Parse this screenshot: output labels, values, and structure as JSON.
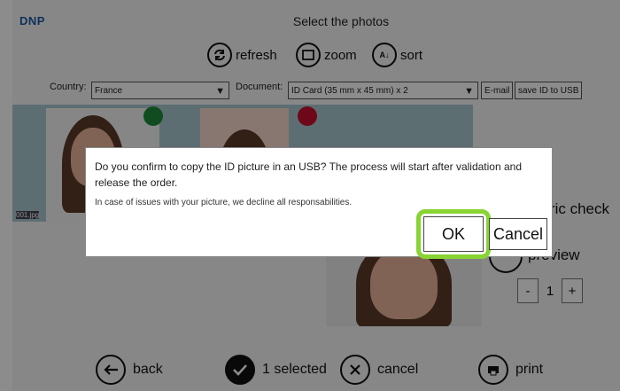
{
  "header": {
    "logo": "DNP",
    "title": "Select the photos"
  },
  "toolbar": {
    "refresh_label": "refresh",
    "zoom_label": "zoom",
    "sort_label": "sort"
  },
  "filters": {
    "country_label": "Country:",
    "country_value": "France",
    "document_label": "Document:",
    "document_value": "ID Card (35 mm x 45 mm) x 2",
    "email_label": "E-mail",
    "save_usb_label": "save ID to USB"
  },
  "photos": [
    {
      "filename": "001.jpg",
      "status_color": "#1e8a3a"
    },
    {
      "filename": "",
      "status_color": "#c8102e"
    }
  ],
  "side_panel": {
    "biometric_label": "Biometric check",
    "preview_label": "preview",
    "quantity": "1",
    "minus_label": "-",
    "plus_label": "+"
  },
  "bottom_bar": {
    "back_label": "back",
    "selected_label": "1 selected",
    "cancel_label": "cancel",
    "print_label": "print"
  },
  "dialog": {
    "message": "Do you confirm to copy the ID picture in an USB? The process will start after validation and release the order.",
    "note": "In case of issues with your picture, we decline all responsabilities.",
    "ok_label": "OK",
    "cancel_label": "Cancel"
  },
  "colors": {
    "highlight": "#88d432",
    "brand": "#1a5aa6"
  }
}
